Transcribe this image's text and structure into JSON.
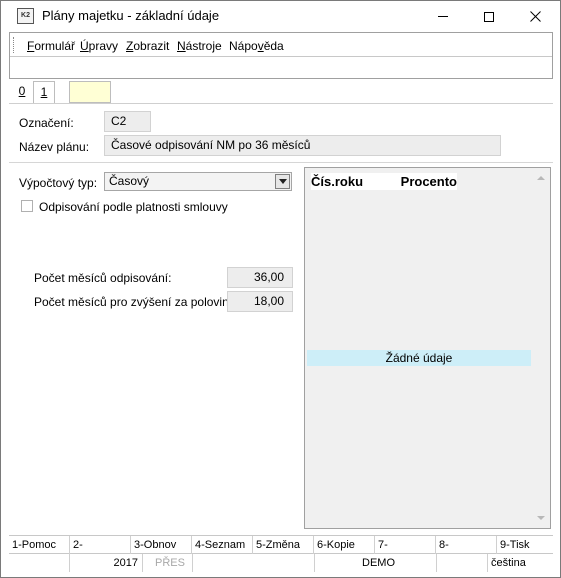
{
  "window": {
    "title": "Plány majetku - základní údaje",
    "icon_text": "K2",
    "controls": [
      "minimize-icon",
      "maximize-icon",
      "close-icon"
    ]
  },
  "menu": {
    "items": [
      {
        "label": "Formulář",
        "hotkey": "F"
      },
      {
        "label": "Úpravy",
        "hotkey": "Ú"
      },
      {
        "label": "Zobrazit",
        "hotkey": "Z"
      },
      {
        "label": "Nástroje",
        "hotkey": "N"
      },
      {
        "label": "Nápověda",
        "hotkey": "v"
      }
    ]
  },
  "tabs": [
    {
      "label": "0"
    },
    {
      "label": "1",
      "active": true
    },
    {
      "label": ""
    }
  ],
  "header": {
    "oznaceni_label": "Označení:",
    "oznaceni_value": "C2",
    "nazev_label": "Název plánu:",
    "nazev_value": "Časové odpisování NM po 36 měsíců"
  },
  "left_panel": {
    "vypoctovy_label": "Výpočtový typ:",
    "vypoctovy_value": "Časový",
    "checkbox_label": "Odpisování podle platnosti smlouvy",
    "checkbox_checked": false,
    "pocet_mesicu_label": "Počet měsíců odpisování:",
    "pocet_mesicu_value": "36,00",
    "pocet_zvyseni_label": "Počet měsíců pro zvýšení za polovinou:",
    "pocet_zvyseni_value": "18,00"
  },
  "grid": {
    "columns": [
      "Čís.roku",
      "Procento"
    ],
    "empty_text": "Žádné údaje"
  },
  "function_keys": [
    "1-Pomoc",
    "2-",
    "3-Obnov",
    "4-Seznam",
    "5-Změna",
    "6-Kopie",
    "7-",
    "8-",
    "9-Tisk"
  ],
  "status": {
    "year": "2017",
    "mode": "PŘES",
    "database": "DEMO",
    "language": "čeština"
  },
  "colors": {
    "empty_row_bg": "#cdeef8",
    "tab_yellow": "#ffffd5",
    "field_bg": "#ededed"
  }
}
